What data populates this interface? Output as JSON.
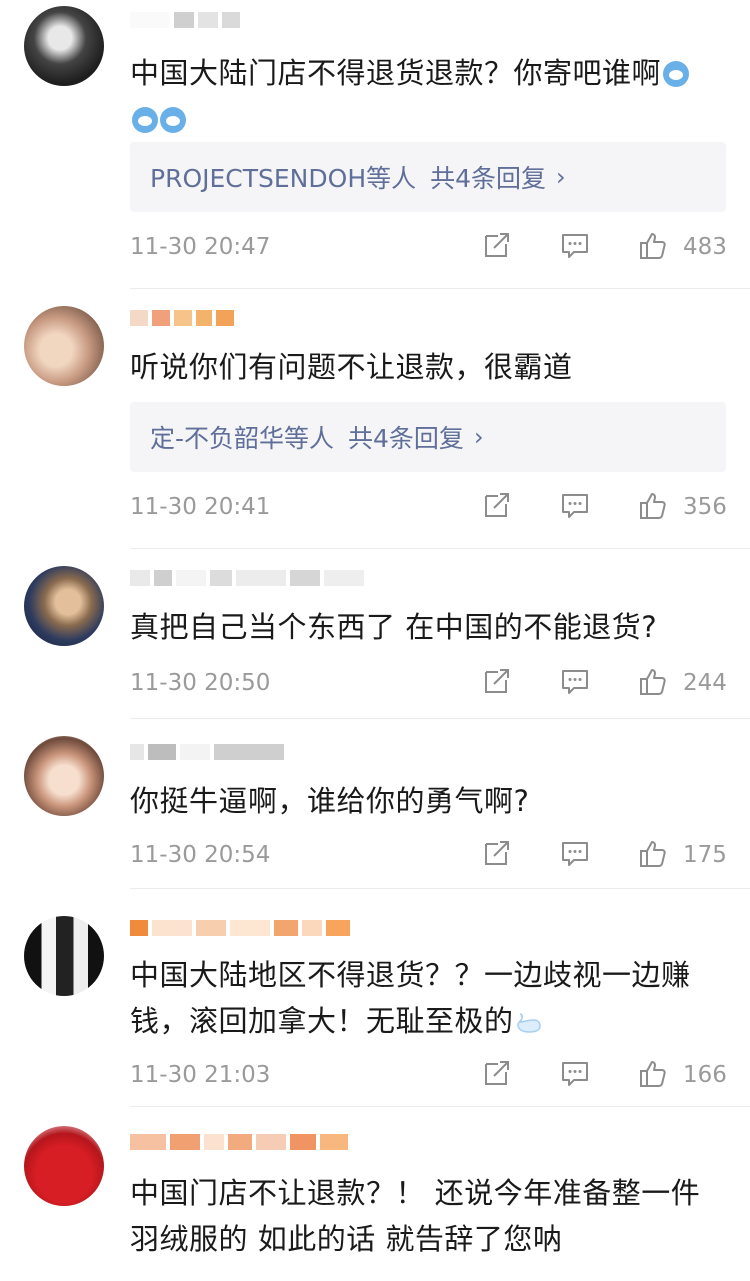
{
  "comments": [
    {
      "text": "中国大陆门店不得退货退款？你寄吧谁啊",
      "reply_name": "PROJECTSENDOH等人",
      "reply_count": "共4条回复",
      "time": "11-30 20:47",
      "likes": "483"
    },
    {
      "text": "听说你们有问题不让退款，很霸道",
      "reply_name": "定-不负韶华等人",
      "reply_count": "共4条回复",
      "time": "11-30 20:41",
      "likes": "356"
    },
    {
      "text": "真把自己当个东西了 在中国的不能退货?",
      "time": "11-30 20:50",
      "likes": "244"
    },
    {
      "text": "你挺牛逼啊，谁给你的勇气啊?",
      "time": "11-30 20:54",
      "likes": "175"
    },
    {
      "text_line1": "中国大陆地区不得退货？？一边歧视一边赚",
      "text_line2": "钱，滚回加拿大！无耻至极的",
      "time": "11-30 21:03",
      "likes": "166"
    },
    {
      "text_line1": "中国门店不让退款？！ 还说今年准备整一件",
      "text_line2": "羽绒服的 如此的话 就告辞了您呐"
    }
  ],
  "icons": {
    "share": "share-icon",
    "comment": "comment-icon",
    "like": "thumbs-up-icon"
  },
  "colors": {
    "reply_link": "#5f6f99",
    "meta_gray": "#9a9a9a",
    "reply_bg": "#f5f5f7"
  }
}
